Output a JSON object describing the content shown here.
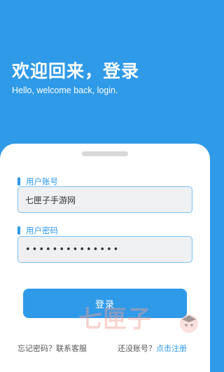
{
  "hero": {
    "title": "欢迎回来，登录",
    "subtitle": "Hello, welcome back, login."
  },
  "form": {
    "account": {
      "label": "用户账号",
      "value": "七匣子手游网"
    },
    "password": {
      "label": "用户密码",
      "value": "••••••••••••••"
    },
    "login_label": "登录"
  },
  "footer": {
    "forgot_label": "忘记密码？联系客服",
    "no_account_label": "还没账号？",
    "register_label": "点击注册"
  },
  "watermark": {
    "text": "七匣子"
  },
  "colors": {
    "primary": "#2f9ae8",
    "card": "#ffffff",
    "field_bg": "#eef0f2"
  }
}
